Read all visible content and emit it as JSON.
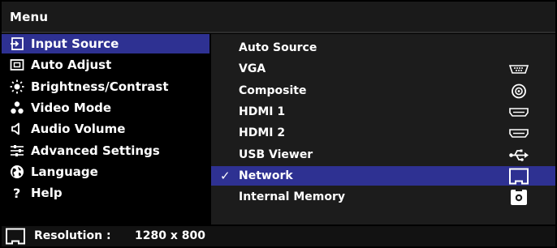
{
  "header": {
    "title": "Menu"
  },
  "colors": {
    "highlight": "#2e3192",
    "panel": "#1c1c1c",
    "background": "#000000",
    "text": "#ffffff"
  },
  "main_menu": {
    "items": [
      {
        "label": "Input Source",
        "icon": "input-source-icon",
        "active": true
      },
      {
        "label": "Auto Adjust",
        "icon": "auto-adjust-icon",
        "active": false
      },
      {
        "label": "Brightness/Contrast",
        "icon": "brightness-icon",
        "active": false
      },
      {
        "label": "Video Mode",
        "icon": "video-mode-icon",
        "active": false
      },
      {
        "label": "Audio Volume",
        "icon": "speaker-icon",
        "active": false
      },
      {
        "label": "Advanced Settings",
        "icon": "advanced-settings-icon",
        "active": false
      },
      {
        "label": "Language",
        "icon": "globe-icon",
        "active": false
      },
      {
        "label": "Help",
        "icon": "help-icon",
        "active": false
      }
    ]
  },
  "input_sources": {
    "items": [
      {
        "label": "Auto Source",
        "icon": "",
        "selected": false,
        "check": ""
      },
      {
        "label": "VGA",
        "icon": "vga-port-icon",
        "selected": false,
        "check": ""
      },
      {
        "label": "Composite",
        "icon": "composite-port-icon",
        "selected": false,
        "check": ""
      },
      {
        "label": "HDMI 1",
        "icon": "hdmi-port-icon",
        "selected": false,
        "check": ""
      },
      {
        "label": "HDMI 2",
        "icon": "hdmi-port-icon",
        "selected": false,
        "check": ""
      },
      {
        "label": "USB Viewer",
        "icon": "usb-icon",
        "selected": false,
        "check": ""
      },
      {
        "label": "Network",
        "icon": "network-port-icon",
        "selected": true,
        "check": "✓"
      },
      {
        "label": "Internal Memory",
        "icon": "internal-memory-icon",
        "selected": false,
        "check": ""
      }
    ]
  },
  "status_bar": {
    "icon": "network-port-icon",
    "resolution_label": "Resolution :",
    "resolution_value": "1280 x 800"
  }
}
